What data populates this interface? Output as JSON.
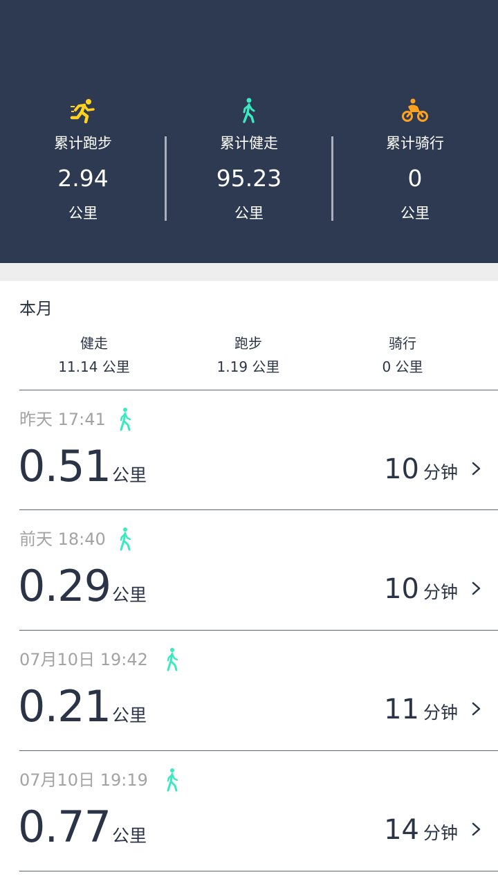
{
  "summary": [
    {
      "icon": "running-icon",
      "label": "累计跑步",
      "value": "2.94",
      "unit": "公里",
      "color": "#ffd21f"
    },
    {
      "icon": "walking-icon",
      "label": "累计健走",
      "value": "95.23",
      "unit": "公里",
      "color": "#3ce8c0"
    },
    {
      "icon": "cycling-icon",
      "label": "累计骑行",
      "value": "0",
      "unit": "公里",
      "color": "#ffa21f"
    }
  ],
  "month": {
    "title": "本月",
    "items": [
      {
        "label": "健走",
        "value": "11.14 公里"
      },
      {
        "label": "跑步",
        "value": "1.19 公里"
      },
      {
        "label": "骑行",
        "value": "0 公里"
      }
    ]
  },
  "records": [
    {
      "time": "昨天 17:41",
      "distance": "0.51",
      "distance_unit": "公里",
      "duration": "10",
      "duration_unit": "分钟",
      "icon": "walking-icon"
    },
    {
      "time": "前天 18:40",
      "distance": "0.29",
      "distance_unit": "公里",
      "duration": "10",
      "duration_unit": "分钟",
      "icon": "walking-icon"
    },
    {
      "time": "07月10日 19:42",
      "distance": "0.21",
      "distance_unit": "公里",
      "duration": "11",
      "duration_unit": "分钟",
      "icon": "walking-icon"
    },
    {
      "time": "07月10日 19:19",
      "distance": "0.77",
      "distance_unit": "公里",
      "duration": "14",
      "duration_unit": "分钟",
      "icon": "walking-icon"
    }
  ],
  "colors": {
    "header_bg": "#2e3a52",
    "walk_icon": "#3ce8c0",
    "text_dark": "#2b3447",
    "text_muted": "#a3a3a3"
  }
}
